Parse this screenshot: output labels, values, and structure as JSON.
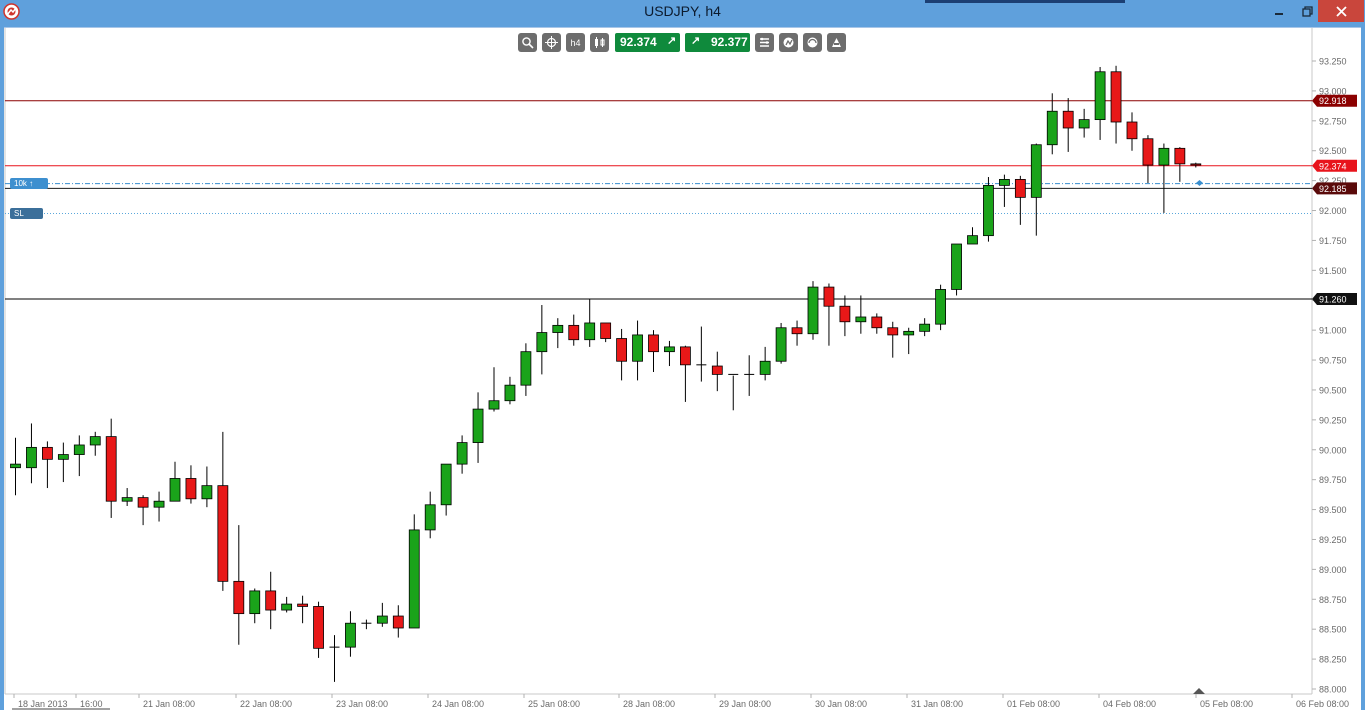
{
  "window": {
    "title": "USDJPY, h4",
    "minimize_glyph": "‒",
    "maximize_glyph": "❐",
    "close_glyph": "✕",
    "app_icon": "app-logo-icon"
  },
  "toolbar": {
    "icons": [
      "zoom-icon",
      "crosshair-icon",
      "timeframe-icon",
      "chart-type-icon"
    ],
    "timeframe_label": "h4",
    "bid": "92.374",
    "ask": "92.377",
    "right_icons": [
      "settings-icon",
      "indicator-icon",
      "template-icon",
      "trade-icon"
    ]
  },
  "order_tags": {
    "tp_label": "10k ↑",
    "sl_label": "SL"
  },
  "chart_data": {
    "type": "candlestick",
    "symbol": "USDJPY",
    "timeframe": "h4",
    "ylim": [
      88.0,
      93.4
    ],
    "y_ticks": [
      "93.250",
      "93.000",
      "92.750",
      "92.500",
      "92.250",
      "92.000",
      "91.750",
      "91.500",
      "91.250",
      "91.000",
      "90.750",
      "90.500",
      "90.250",
      "90.000",
      "89.750",
      "89.500",
      "89.250",
      "89.000",
      "88.750",
      "88.500",
      "88.250",
      "88.000"
    ],
    "x_labels": [
      "18 Jan 2013",
      "16:00",
      "21 Jan 08:00",
      "22 Jan 08:00",
      "23 Jan 08:00",
      "24 Jan 08:00",
      "25 Jan 08:00",
      "28 Jan 08:00",
      "29 Jan 08:00",
      "30 Jan 08:00",
      "31 Jan 08:00",
      "01 Feb 08:00",
      "04 Feb 08:00",
      "05 Feb 08:00",
      "06 Feb 08:00"
    ],
    "price_lines": [
      {
        "label": "92.918",
        "value": 92.918,
        "color": "#8b0000",
        "style": "solid"
      },
      {
        "label": "92.374",
        "value": 92.374,
        "color": "#e8141c",
        "style": "solid"
      },
      {
        "label": "92.185",
        "value": 92.185,
        "color": "#1a1a1a",
        "style": "solid"
      },
      {
        "label": "91.260",
        "value": 91.26,
        "color": "#000000",
        "style": "solid"
      }
    ],
    "order_lines": [
      {
        "value": 92.225,
        "color": "#3a8fcf",
        "style": "dashdot"
      },
      {
        "value": 91.975,
        "color": "#5aa7db",
        "style": "dotted"
      }
    ],
    "up_color": "#1aa31a",
    "down_color": "#e81818",
    "candles": [
      [
        89.85,
        89.88,
        89.62,
        90.1
      ],
      [
        89.85,
        90.02,
        89.72,
        90.22
      ],
      [
        90.02,
        89.92,
        89.68,
        90.07
      ],
      [
        89.92,
        89.96,
        89.73,
        90.06
      ],
      [
        89.96,
        90.04,
        89.78,
        90.12
      ],
      [
        90.04,
        90.11,
        89.95,
        90.15
      ],
      [
        90.11,
        89.57,
        89.43,
        90.26
      ],
      [
        89.57,
        89.6,
        89.53,
        89.68
      ],
      [
        89.6,
        89.52,
        89.37,
        89.62
      ],
      [
        89.52,
        89.57,
        89.4,
        89.65
      ],
      [
        89.57,
        89.76,
        89.57,
        89.9
      ],
      [
        89.76,
        89.59,
        89.55,
        89.87
      ],
      [
        89.59,
        89.7,
        89.52,
        89.86
      ],
      [
        89.7,
        88.9,
        88.82,
        90.15
      ],
      [
        88.9,
        88.63,
        88.37,
        89.37
      ],
      [
        88.63,
        88.82,
        88.55,
        88.84
      ],
      [
        88.82,
        88.66,
        88.5,
        88.98
      ],
      [
        88.66,
        88.71,
        88.64,
        88.77
      ],
      [
        88.71,
        88.69,
        88.55,
        88.78
      ],
      [
        88.69,
        88.34,
        88.26,
        88.73
      ],
      [
        88.34,
        88.35,
        88.06,
        88.45
      ],
      [
        88.35,
        88.55,
        88.27,
        88.65
      ],
      [
        88.55,
        88.55,
        88.5,
        88.58
      ],
      [
        88.55,
        88.61,
        88.52,
        88.72
      ],
      [
        88.61,
        88.51,
        88.43,
        88.7
      ],
      [
        88.51,
        89.33,
        88.51,
        89.46
      ],
      [
        89.33,
        89.54,
        89.26,
        89.65
      ],
      [
        89.54,
        89.88,
        89.45,
        89.88
      ],
      [
        89.88,
        90.06,
        89.8,
        90.12
      ],
      [
        90.06,
        90.34,
        89.89,
        90.48
      ],
      [
        90.34,
        90.41,
        90.32,
        90.69
      ],
      [
        90.41,
        90.54,
        90.38,
        90.61
      ],
      [
        90.54,
        90.82,
        90.45,
        90.89
      ],
      [
        90.82,
        90.98,
        90.63,
        91.21
      ],
      [
        90.98,
        91.04,
        90.85,
        91.1
      ],
      [
        91.04,
        90.92,
        90.87,
        91.13
      ],
      [
        90.92,
        91.06,
        90.86,
        91.26
      ],
      [
        91.06,
        90.93,
        90.9,
        91.0
      ],
      [
        90.93,
        90.74,
        90.58,
        91.01
      ],
      [
        90.74,
        90.96,
        90.58,
        91.08
      ],
      [
        90.96,
        90.82,
        90.65,
        91.0
      ],
      [
        90.82,
        90.86,
        90.7,
        90.91
      ],
      [
        90.86,
        90.71,
        90.4,
        90.87
      ],
      [
        90.71,
        90.7,
        90.57,
        91.03
      ],
      [
        90.7,
        90.63,
        90.49,
        90.82
      ],
      [
        90.63,
        90.62,
        90.33,
        90.62
      ],
      [
        90.62,
        90.63,
        90.45,
        90.79
      ],
      [
        90.63,
        90.74,
        90.58,
        90.86
      ],
      [
        90.74,
        91.02,
        90.72,
        91.06
      ],
      [
        91.02,
        90.97,
        90.87,
        91.08
      ],
      [
        90.97,
        91.36,
        90.92,
        91.41
      ],
      [
        91.36,
        91.2,
        90.87,
        91.39
      ],
      [
        91.2,
        91.07,
        90.95,
        91.29
      ],
      [
        91.07,
        91.11,
        90.97,
        91.29
      ],
      [
        91.11,
        91.02,
        90.97,
        91.14
      ],
      [
        91.02,
        90.96,
        90.77,
        91.07
      ],
      [
        90.96,
        90.99,
        90.8,
        91.02
      ],
      [
        90.99,
        91.05,
        90.95,
        91.1
      ],
      [
        91.05,
        91.34,
        91.0,
        91.38
      ],
      [
        91.34,
        91.72,
        91.29,
        91.72
      ],
      [
        91.72,
        91.79,
        91.76,
        91.86
      ],
      [
        91.79,
        92.21,
        91.74,
        92.28
      ],
      [
        92.21,
        92.26,
        92.03,
        92.3
      ],
      [
        92.26,
        92.11,
        91.88,
        92.29
      ],
      [
        92.11,
        92.55,
        91.79,
        92.56
      ],
      [
        92.55,
        92.83,
        92.47,
        92.98
      ],
      [
        92.83,
        92.69,
        92.49,
        92.94
      ],
      [
        92.69,
        92.76,
        92.61,
        92.85
      ],
      [
        92.76,
        93.16,
        92.59,
        93.2
      ],
      [
        93.16,
        92.74,
        92.56,
        93.21
      ],
      [
        92.74,
        92.6,
        92.5,
        92.82
      ],
      [
        92.6,
        92.38,
        92.23,
        92.63
      ],
      [
        92.38,
        92.52,
        91.98,
        92.56
      ],
      [
        92.52,
        92.39,
        92.24,
        92.53
      ],
      [
        92.39,
        92.38,
        92.36,
        92.4
      ]
    ]
  }
}
